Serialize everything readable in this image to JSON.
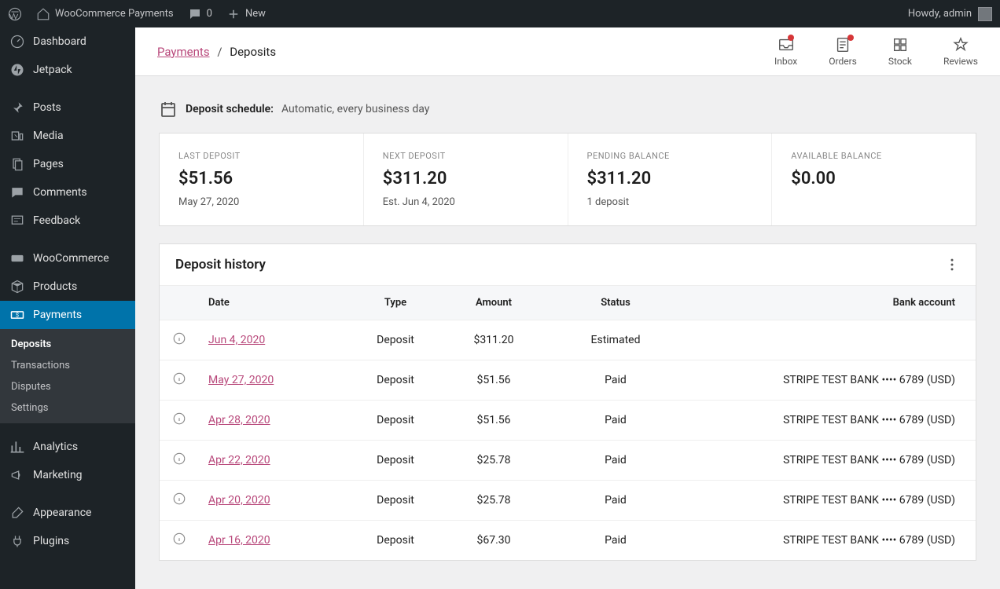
{
  "adminbar": {
    "site_name": "WooCommerce Payments",
    "comment_count": "0",
    "new_label": "New",
    "howdy": "Howdy, admin"
  },
  "sidebar": {
    "items": [
      {
        "label": "Dashboard",
        "icon": "gauge"
      },
      {
        "label": "Jetpack",
        "icon": "jetpack"
      },
      {
        "label": "Posts",
        "icon": "pin"
      },
      {
        "label": "Media",
        "icon": "media"
      },
      {
        "label": "Pages",
        "icon": "pages"
      },
      {
        "label": "Comments",
        "icon": "comment"
      },
      {
        "label": "Feedback",
        "icon": "feedback"
      },
      {
        "label": "WooCommerce",
        "icon": "woo"
      },
      {
        "label": "Products",
        "icon": "box"
      },
      {
        "label": "Payments",
        "icon": "cash"
      },
      {
        "label": "Analytics",
        "icon": "stats"
      },
      {
        "label": "Marketing",
        "icon": "megaphone"
      },
      {
        "label": "Appearance",
        "icon": "brush"
      },
      {
        "label": "Plugins",
        "icon": "plug"
      }
    ],
    "submenu": [
      {
        "label": "Deposits",
        "current": true
      },
      {
        "label": "Transactions"
      },
      {
        "label": "Disputes"
      },
      {
        "label": "Settings"
      }
    ]
  },
  "breadcrumb": {
    "parent": "Payments",
    "current": "Deposits"
  },
  "topnav": {
    "inbox": "Inbox",
    "orders": "Orders",
    "stock": "Stock",
    "reviews": "Reviews"
  },
  "schedule": {
    "label": "Deposit schedule:",
    "value": "Automatic, every business day"
  },
  "summary": [
    {
      "title": "LAST DEPOSIT",
      "amount": "$51.56",
      "sub": "May 27, 2020"
    },
    {
      "title": "NEXT DEPOSIT",
      "amount": "$311.20",
      "sub": "Est. Jun 4, 2020"
    },
    {
      "title": "PENDING BALANCE",
      "amount": "$311.20",
      "sub": "1 deposit"
    },
    {
      "title": "AVAILABLE BALANCE",
      "amount": "$0.00",
      "sub": ""
    }
  ],
  "history": {
    "title": "Deposit history",
    "columns": {
      "date": "Date",
      "type": "Type",
      "amount": "Amount",
      "status": "Status",
      "bank": "Bank account"
    },
    "rows": [
      {
        "date": "Jun 4, 2020",
        "type": "Deposit",
        "amount": "$311.20",
        "status": "Estimated",
        "bank": ""
      },
      {
        "date": "May 27, 2020",
        "type": "Deposit",
        "amount": "$51.56",
        "status": "Paid",
        "bank": "STRIPE TEST BANK •••• 6789 (USD)"
      },
      {
        "date": "Apr 28, 2020",
        "type": "Deposit",
        "amount": "$51.56",
        "status": "Paid",
        "bank": "STRIPE TEST BANK •••• 6789 (USD)"
      },
      {
        "date": "Apr 22, 2020",
        "type": "Deposit",
        "amount": "$25.78",
        "status": "Paid",
        "bank": "STRIPE TEST BANK •••• 6789 (USD)"
      },
      {
        "date": "Apr 20, 2020",
        "type": "Deposit",
        "amount": "$25.78",
        "status": "Paid",
        "bank": "STRIPE TEST BANK •••• 6789 (USD)"
      },
      {
        "date": "Apr 16, 2020",
        "type": "Deposit",
        "amount": "$67.30",
        "status": "Paid",
        "bank": "STRIPE TEST BANK •••• 6789 (USD)"
      }
    ]
  }
}
